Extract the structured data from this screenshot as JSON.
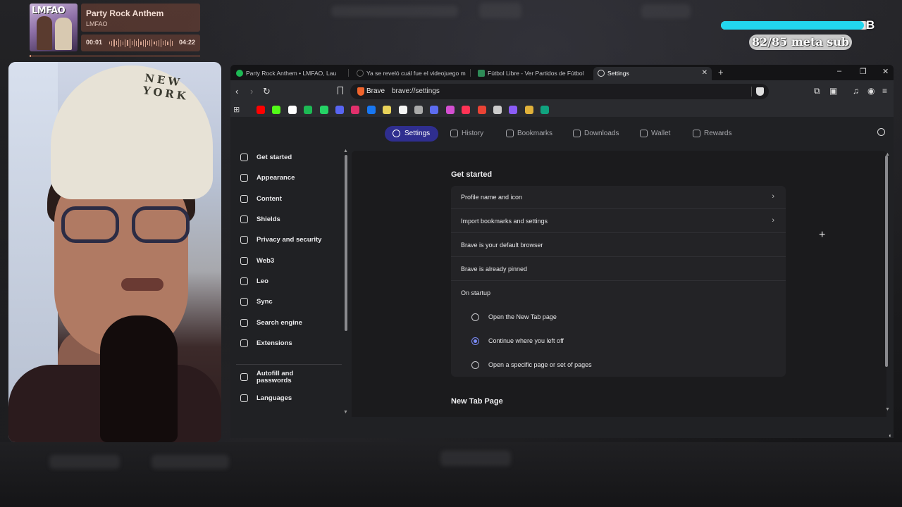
{
  "music": {
    "album_logo": "LMFAO",
    "title": "Party Rock Anthem",
    "artist": "LMFAO",
    "time_current": "00:01",
    "time_total": "04:22",
    "progress": 0.004
  },
  "sub_goal": {
    "logo": "B",
    "text": "82/85 meta sub",
    "current": 82,
    "target": 85
  },
  "webcam": {
    "cap_text": "NEW YORK"
  },
  "browser": {
    "tabs": [
      {
        "label": "Party Rock Anthem • LMFAO, Lau",
        "icon": "spotify-icon",
        "color": "#1db954"
      },
      {
        "label": "Ya se reveló cuál fue el videojuego m",
        "icon": "tiktok-icon",
        "color": "#111111"
      },
      {
        "label": "Fútbol Libre - Ver Partidos de Fútbol",
        "icon": "futbol-icon",
        "color": "#2e8b57"
      },
      {
        "label": "Settings",
        "icon": "gear-icon",
        "color": "#cccccc",
        "active": true
      }
    ],
    "window_controls": {
      "minimize": "–",
      "restore": "❐",
      "close": "✕",
      "new_tab": "+",
      "tab_close": "✕"
    },
    "toolbar": {
      "back": "‹",
      "forward": "›",
      "reload": "↻"
    },
    "url": {
      "brand": "Brave",
      "address": "brave://settings"
    },
    "bookmarks": [
      {
        "name": "youtube-icon",
        "color": "#ff0000"
      },
      {
        "name": "kick-icon",
        "color": "#53fc18"
      },
      {
        "name": "x-icon",
        "color": "#ffffff"
      },
      {
        "name": "spotify-icon",
        "color": "#1db954"
      },
      {
        "name": "whatsapp-icon",
        "color": "#25d366"
      },
      {
        "name": "discord-icon",
        "color": "#5865f2"
      },
      {
        "name": "instagram-icon",
        "color": "#e1306c"
      },
      {
        "name": "facebook-icon",
        "color": "#1877f2"
      },
      {
        "name": "bookmark-yellow-icon",
        "color": "#e8d25a"
      },
      {
        "name": "amazon-icon",
        "color": "#f5f5f5"
      },
      {
        "name": "chatgpt-icon",
        "color": "#aaaaaa"
      },
      {
        "name": "site-blue-icon",
        "color": "#5c6cf0"
      },
      {
        "name": "site-multi-icon",
        "color": "#d44fd1"
      },
      {
        "name": "bolt-icon",
        "color": "#ff3355"
      },
      {
        "name": "chrome-icon",
        "color": "#ea4335"
      },
      {
        "name": "site-gray-icon",
        "color": "#cccccc"
      },
      {
        "name": "site-purple-icon",
        "color": "#8b5cf6"
      },
      {
        "name": "cookie-icon",
        "color": "#e0b13a"
      },
      {
        "name": "site-green-icon",
        "color": "#10a37f"
      }
    ],
    "settings_nav": [
      {
        "label": "Settings",
        "icon": "gear-icon",
        "active": true
      },
      {
        "label": "History",
        "icon": "history-icon"
      },
      {
        "label": "Bookmarks",
        "icon": "bookmarks-icon"
      },
      {
        "label": "Downloads",
        "icon": "download-icon"
      },
      {
        "label": "Wallet",
        "icon": "wallet-icon"
      },
      {
        "label": "Rewards",
        "icon": "rewards-icon"
      }
    ],
    "sidebar": [
      {
        "label": "Get started",
        "icon": "rocket-icon"
      },
      {
        "label": "Appearance",
        "icon": "palette-icon"
      },
      {
        "label": "Content",
        "icon": "content-icon"
      },
      {
        "label": "Shields",
        "icon": "shield-icon"
      },
      {
        "label": "Privacy and security",
        "icon": "lock-icon"
      },
      {
        "label": "Web3",
        "icon": "wallet-icon"
      },
      {
        "label": "Leo",
        "icon": "leo-icon"
      },
      {
        "label": "Sync",
        "icon": "sync-icon"
      },
      {
        "label": "Search engine",
        "icon": "search-icon"
      },
      {
        "label": "Extensions",
        "icon": "puzzle-icon"
      },
      {
        "label": "Autofill and passwords",
        "icon": "list-icon"
      },
      {
        "label": "Languages",
        "icon": "languages-icon"
      }
    ],
    "content": {
      "section_title": "Get started",
      "rows": [
        {
          "label": "Profile name and icon",
          "chevron": "›"
        },
        {
          "label": "Import bookmarks and settings",
          "chevron": "›"
        },
        {
          "label": "Brave is your default browser"
        },
        {
          "label": "Brave is already pinned"
        },
        {
          "label": "On startup"
        }
      ],
      "startup_options": [
        {
          "label": "Open the New Tab page",
          "selected": false
        },
        {
          "label": "Continue where you left off",
          "selected": true
        },
        {
          "label": "Open a specific page or set of pages",
          "selected": false
        }
      ],
      "next_section_title": "New Tab Page"
    }
  }
}
